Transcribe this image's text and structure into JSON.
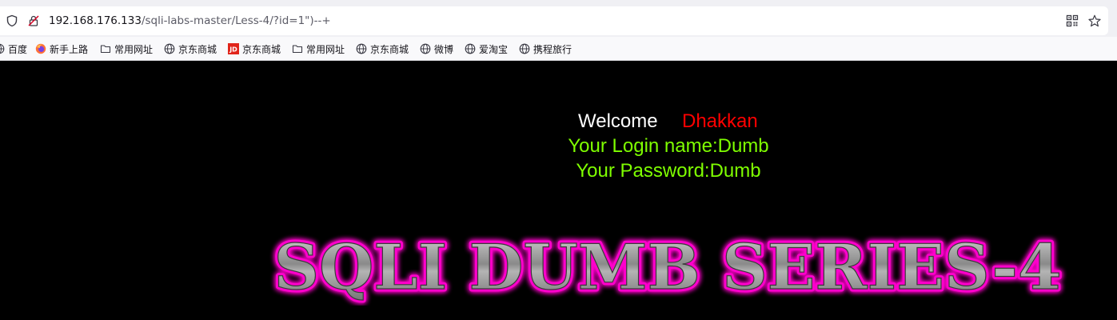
{
  "browser": {
    "url_host": "192.168.176.133",
    "url_path": "/sqli-labs-master/Less-4/?id=1\")--+",
    "bookmarks": [
      {
        "label": "百度",
        "icon": "globe-icon"
      },
      {
        "label": "新手上路",
        "icon": "firefox-icon"
      },
      {
        "label": "常用网址",
        "icon": "folder-icon"
      },
      {
        "label": "京东商城",
        "icon": "globe-icon"
      },
      {
        "label": "京东商城",
        "icon": "jd-icon"
      },
      {
        "label": "常用网址",
        "icon": "folder-icon"
      },
      {
        "label": "京东商城",
        "icon": "globe-icon"
      },
      {
        "label": "微博",
        "icon": "globe-icon"
      },
      {
        "label": "爱淘宝",
        "icon": "globe-icon"
      },
      {
        "label": "携程旅行",
        "icon": "globe-icon"
      }
    ]
  },
  "page": {
    "welcome_text": "Welcome",
    "welcome_name": "Dhakkan",
    "login_line": "Your Login name:Dumb",
    "password_line": "Your Password:Dumb",
    "banner_text": "SQLI DUMB SERIES-4"
  },
  "colors": {
    "background": "#000000",
    "welcome": "#ffffff",
    "name": "#ff0000",
    "info": "#7fff00",
    "banner_glow": "#ff00cc",
    "banner_fill": "#9a9a9a"
  }
}
